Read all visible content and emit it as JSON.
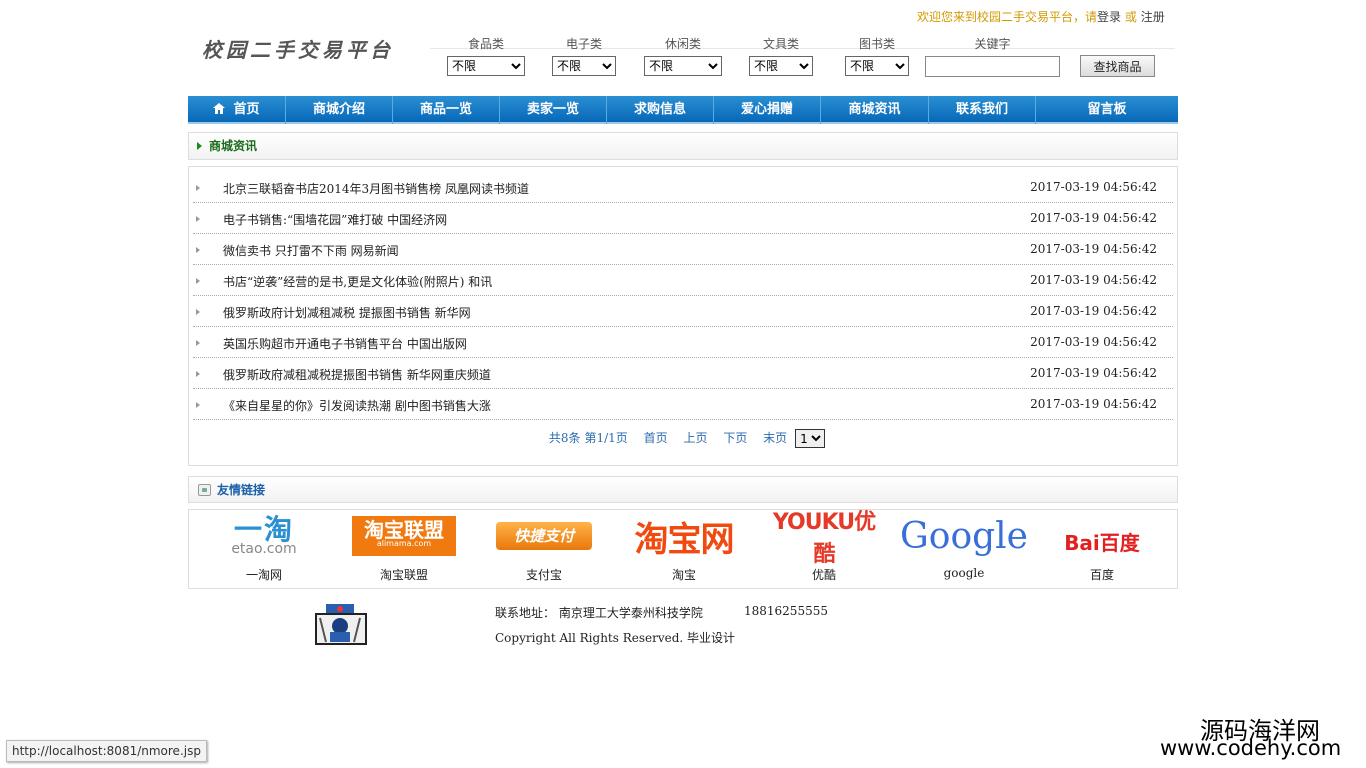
{
  "header": {
    "welcome_text": "欢迎您来到校园二手交易平台，请",
    "login": "登录",
    "or": "或",
    "register": "注册",
    "logo_text": "校园二手交易平台"
  },
  "search": {
    "filters": [
      {
        "label": "食品类",
        "value": "不限"
      },
      {
        "label": "电子类",
        "value": "不限"
      },
      {
        "label": "休闲类",
        "value": "不限"
      },
      {
        "label": "文具类",
        "value": "不限"
      },
      {
        "label": "图书类",
        "value": "不限"
      }
    ],
    "keyword_label": "关键字",
    "keyword_value": "",
    "button": "查找商品"
  },
  "nav": {
    "items": [
      "首页",
      "商城介绍",
      "商品一览",
      "卖家一览",
      "求购信息",
      "爱心捐赠",
      "商城资讯",
      "联系我们",
      "留言板"
    ]
  },
  "news": {
    "title": "商城资讯",
    "items": [
      {
        "title": "北京三联韬奋书店2014年3月图书销售榜 凤凰网读书频道",
        "date": "2017-03-19 04:56:42"
      },
      {
        "title": "电子书销售:“围墙花园”难打破 中国经济网",
        "date": "2017-03-19 04:56:42"
      },
      {
        "title": "微信卖书 只打雷不下雨 网易新闻",
        "date": "2017-03-19 04:56:42"
      },
      {
        "title": "书店“逆袭”经营的是书,更是文化体验(附照片) 和讯",
        "date": "2017-03-19 04:56:42"
      },
      {
        "title": "俄罗斯政府计划减租减税 提振图书销售 新华网",
        "date": "2017-03-19 04:56:42"
      },
      {
        "title": "英国乐购超市开通电子书销售平台 中国出版网",
        "date": "2017-03-19 04:56:42"
      },
      {
        "title": "俄罗斯政府减租减税提振图书销售 新华网重庆频道",
        "date": "2017-03-19 04:56:42"
      },
      {
        "title": "《来自星星的你》引发阅读热潮 剧中图书销售大涨",
        "date": "2017-03-19 04:56:42"
      }
    ],
    "pager": {
      "total": "共8条",
      "page_info": "第1/1页",
      "first": "首页",
      "prev": "上页",
      "next": "下页",
      "last": "末页",
      "page_select": "1"
    }
  },
  "links": {
    "title": "友情链接",
    "items": [
      {
        "logo_text": "一淘",
        "logo_sub": "etao.com",
        "caption": "一淘网"
      },
      {
        "logo_text": "淘宝联盟",
        "logo_sub": "alimama.com",
        "caption": "淘宝联盟"
      },
      {
        "logo_text": "快捷支付",
        "logo_sub": "",
        "caption": "支付宝"
      },
      {
        "logo_text": "淘宝网",
        "logo_sub": "",
        "caption": "淘宝"
      },
      {
        "logo_text": "YOUKU优酷",
        "logo_sub": "",
        "caption": "优酷"
      },
      {
        "logo_text": "Google",
        "logo_sub": "",
        "caption": "google"
      },
      {
        "logo_text": "Bai百度",
        "logo_sub": "",
        "caption": "百度"
      }
    ]
  },
  "footer": {
    "address": "联系地址：  南京理工大学泰州科技学院",
    "phone": "18816255555",
    "copyright": "Copyright All Rights Reserved. 毕业设计"
  },
  "status_url": "http://localhost:8081/nmore.jsp",
  "watermark": {
    "line1": "源码海洋网",
    "line2": "www.codehy.com"
  },
  "colors": {
    "nav_blue": "#0868b8",
    "link_blue": "#2b6cb0",
    "welcome_gold": "#d29a00",
    "section_green": "#1a6b1a"
  }
}
